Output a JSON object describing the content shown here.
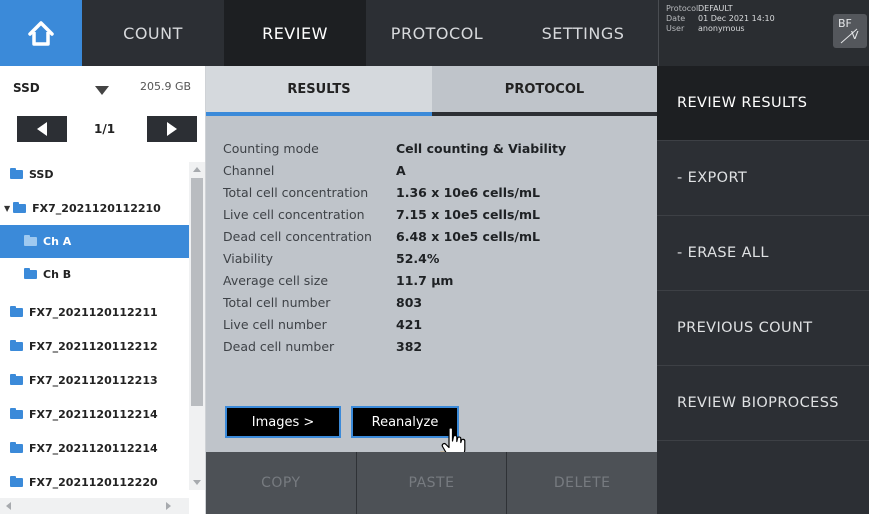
{
  "nav": {
    "home_icon": "home-icon",
    "tabs": [
      {
        "label": "COUNT"
      },
      {
        "label": "REVIEW"
      },
      {
        "label": "PROTOCOL"
      },
      {
        "label": "SETTINGS"
      }
    ]
  },
  "info": {
    "protocol_key": "Protocol",
    "protocol_val": "DEFAULT",
    "date_key": "Date",
    "date_val": "01 Dec 2021 14:10",
    "user_key": "User",
    "user_val": "anonymous",
    "badge_top": "BF",
    "badge_bottom": "V"
  },
  "files": {
    "drive": "SSD",
    "drive_size": "205.9 GB",
    "page": "1/1",
    "tree": [
      {
        "label": "SSD"
      },
      {
        "label": "FX7_2021120112210"
      },
      {
        "label": "Ch A"
      },
      {
        "label": "Ch B"
      },
      {
        "label": "FX7_2021120112211"
      },
      {
        "label": "FX7_2021120112212"
      },
      {
        "label": "FX7_2021120112213"
      },
      {
        "label": "FX7_2021120112214"
      },
      {
        "label": "FX7_2021120112214"
      },
      {
        "label": "FX7_2021120112220"
      }
    ]
  },
  "center": {
    "tab_results": "RESULTS",
    "tab_protocol": "PROTOCOL",
    "results": [
      {
        "label": "Counting mode",
        "value": "Cell counting & Viability"
      },
      {
        "label": "Channel",
        "value": "A"
      },
      {
        "label": "Total cell concentration",
        "value": "1.36 x 10e6 cells/mL"
      },
      {
        "label": "Live cell concentration",
        "value": "7.15 x 10e5 cells/mL"
      },
      {
        "label": "Dead cell concentration",
        "value": "6.48 x 10e5 cells/mL"
      },
      {
        "label": "Viability",
        "value": "52.4%"
      },
      {
        "label": "Average cell size",
        "value": "11.7 µm"
      },
      {
        "label": "Total cell number",
        "value": "803"
      },
      {
        "label": "Live cell number",
        "value": "421"
      },
      {
        "label": "Dead cell number",
        "value": "382"
      }
    ],
    "images_btn": "Images >",
    "reanalyze_btn": "Reanalyze",
    "copy": "COPY",
    "paste": "PASTE",
    "delete": "DELETE"
  },
  "menu": {
    "items": [
      {
        "label": "REVIEW RESULTS"
      },
      {
        "label": "- EXPORT"
      },
      {
        "label": "- ERASE ALL"
      },
      {
        "label": "PREVIOUS COUNT"
      },
      {
        "label": "REVIEW BIOPROCESS"
      }
    ]
  },
  "colors": {
    "accent": "#3b8ad9",
    "dark": "#2c2f34",
    "panel": "#bfc4ca"
  }
}
